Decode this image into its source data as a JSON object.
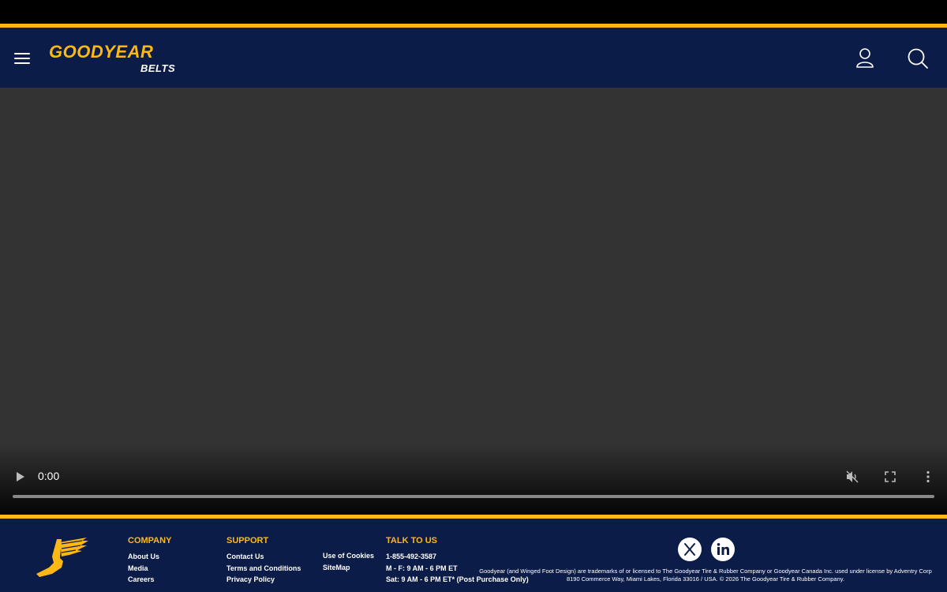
{
  "header": {
    "logo_main": "GOODYEAR",
    "logo_sub": "BELTS"
  },
  "video": {
    "time": "0:00",
    "progress": 0
  },
  "footer": {
    "company": {
      "title": "COMPANY",
      "links": [
        "About Us",
        "Media",
        "Careers"
      ]
    },
    "support": {
      "title": "SUPPORT",
      "links": [
        "Contact Us",
        "Terms and Conditions",
        "Privacy Policy"
      ],
      "links2": [
        "Use of Cookies",
        "SiteMap"
      ]
    },
    "talk": {
      "title": "TALK TO US",
      "phone": "1-855-492-3587",
      "hours1": "M - F: 9 AM - 6 PM ET",
      "hours2": "Sat: 9 AM - 6 PM ET* (Post Purchase Only)"
    },
    "social": [
      "x-icon",
      "linkedin-icon"
    ],
    "legal1": "Goodyear (and Winged Foot Design) are trademarks of or licensed to The Goodyear Tire & Rubber Company or Goodyear Canada Inc. used under license by Adventry Corp",
    "legal2": "8190 Commerce Way, Miami Lakes, Florida 33016 / USA. © 2026 The Goodyear Tire & Rubber Company."
  },
  "colors": {
    "navy": "#0c1c48",
    "gold": "#fdb913",
    "video_bg": "#333333"
  }
}
